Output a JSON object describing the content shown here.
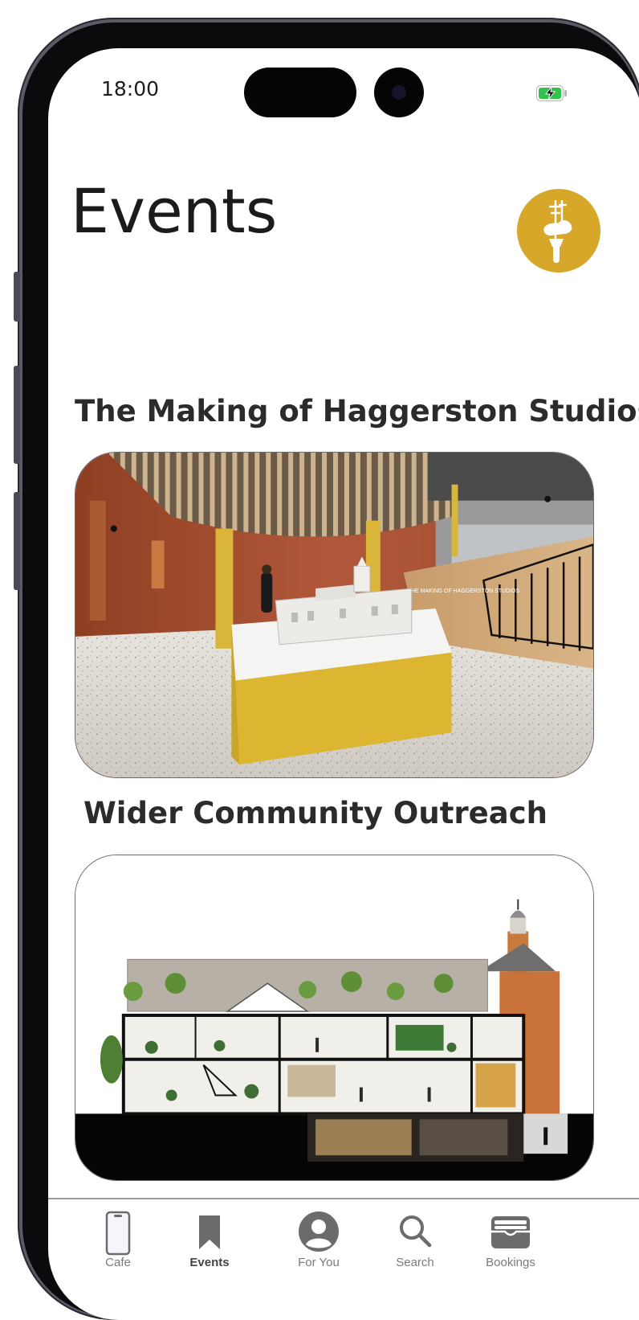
{
  "status_bar": {
    "time": "18:00",
    "battery_icon": "battery-charging-icon"
  },
  "header": {
    "title": "Events",
    "logo_icon": "weathervane-logo-icon",
    "logo_color": "#d7a72a"
  },
  "events": [
    {
      "title": "The Making of Haggerston Studios",
      "image_icon": "exhibition-interior-image",
      "image_caption": "THE MAKING OF HAGGERSTON STUDIOS"
    },
    {
      "title": "Wider Community Outreach",
      "image_icon": "building-section-image"
    }
  ],
  "tab_bar": {
    "active": "Events",
    "items": [
      {
        "label": "Cafe",
        "icon": "phone-icon"
      },
      {
        "label": "Events",
        "icon": "bookmark-icon"
      },
      {
        "label": "For You",
        "icon": "user-circle-icon"
      },
      {
        "label": "Search",
        "icon": "search-icon"
      },
      {
        "label": "Bookings",
        "icon": "wallet-icon"
      }
    ]
  },
  "colors": {
    "accent_gold": "#d7a72a",
    "battery_green": "#33c24d",
    "text_dark": "#1b1b1b",
    "tab_inactive": "#7a7a7a"
  }
}
